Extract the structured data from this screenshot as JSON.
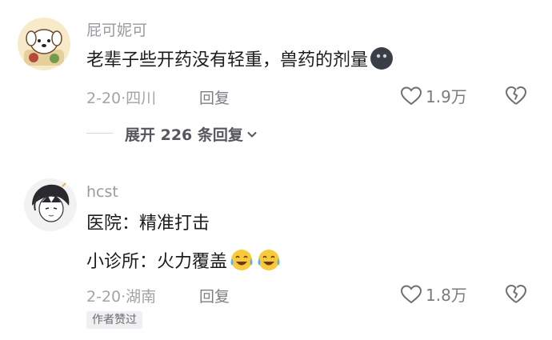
{
  "comments": [
    {
      "username": "屁可妮可",
      "text": "老辈子些开药没有轻重，兽药的剂量",
      "emoji": "dark-round-face-emoji",
      "date": "2-20",
      "sep": "·",
      "location": "四川",
      "reply_label": "回复",
      "likes": "1.9万"
    },
    {
      "username": "hcst",
      "line1": "医院：精准打击",
      "line2": "小诊所：火力覆盖",
      "emoji": "crying-laughing-emoji",
      "date": "2-20",
      "sep": "·",
      "location": "湖南",
      "reply_label": "回复",
      "likes": "1.8万",
      "badge": "作者赞过"
    }
  ],
  "expand_replies": {
    "label": "展开 226 条回复"
  }
}
